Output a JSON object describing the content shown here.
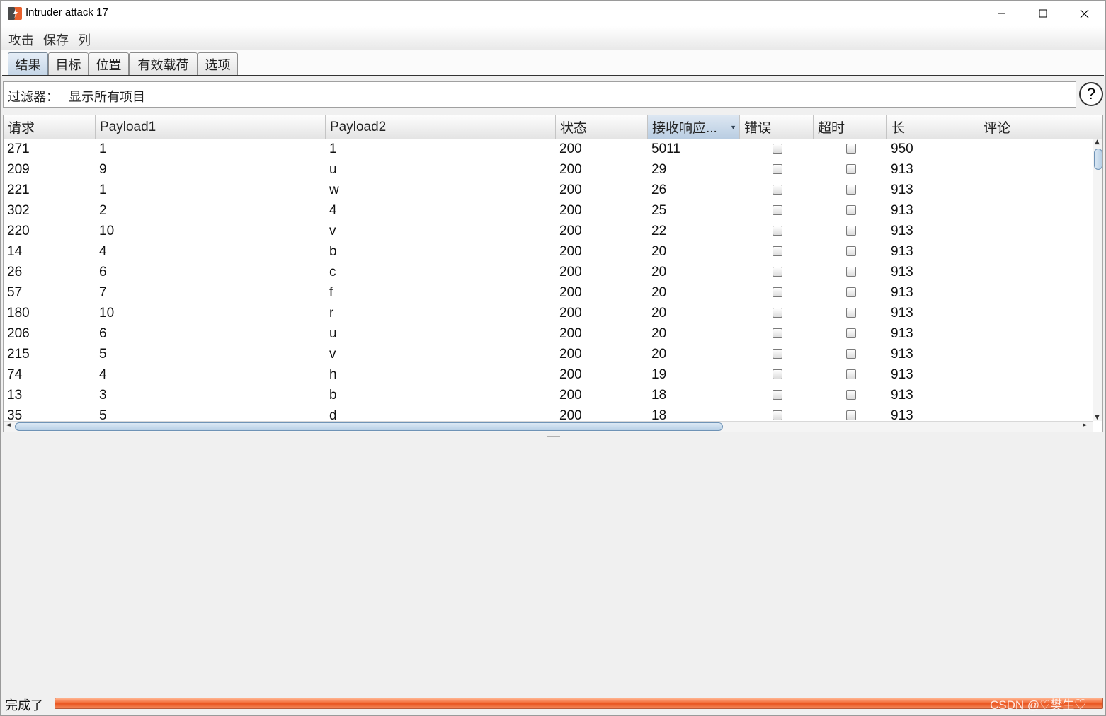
{
  "window": {
    "title": "Intruder attack 17",
    "icon": "burp-app-icon",
    "controls": [
      "minimize-icon",
      "maximize-icon",
      "close-icon"
    ]
  },
  "menu": [
    "攻击",
    "保存",
    "列"
  ],
  "tabs": [
    {
      "label": "结果",
      "active": true
    },
    {
      "label": "目标",
      "active": false
    },
    {
      "label": "位置",
      "active": false
    },
    {
      "label": "有效载荷",
      "active": false
    },
    {
      "label": "选项",
      "active": false
    }
  ],
  "filter": {
    "label": "过滤器：",
    "value": "显示所有项目",
    "help": "?"
  },
  "table": {
    "columns": [
      "请求",
      "Payload1",
      "Payload2",
      "状态",
      "接收响应...",
      "错误",
      "超时",
      "长",
      "评论"
    ],
    "sorted_column": "接收响应...",
    "rows": [
      {
        "request": "271",
        "payload1": "1",
        "payload2": "1",
        "status": "200",
        "response_time": "5011",
        "error": false,
        "timeout": false,
        "length": "950",
        "comment": ""
      },
      {
        "request": "209",
        "payload1": "9",
        "payload2": "u",
        "status": "200",
        "response_time": "29",
        "error": false,
        "timeout": false,
        "length": "913",
        "comment": ""
      },
      {
        "request": "221",
        "payload1": "1",
        "payload2": "w",
        "status": "200",
        "response_time": "26",
        "error": false,
        "timeout": false,
        "length": "913",
        "comment": ""
      },
      {
        "request": "302",
        "payload1": "2",
        "payload2": "4",
        "status": "200",
        "response_time": "25",
        "error": false,
        "timeout": false,
        "length": "913",
        "comment": ""
      },
      {
        "request": "220",
        "payload1": "10",
        "payload2": "v",
        "status": "200",
        "response_time": "22",
        "error": false,
        "timeout": false,
        "length": "913",
        "comment": ""
      },
      {
        "request": "14",
        "payload1": "4",
        "payload2": "b",
        "status": "200",
        "response_time": "20",
        "error": false,
        "timeout": false,
        "length": "913",
        "comment": ""
      },
      {
        "request": "26",
        "payload1": "6",
        "payload2": "c",
        "status": "200",
        "response_time": "20",
        "error": false,
        "timeout": false,
        "length": "913",
        "comment": ""
      },
      {
        "request": "57",
        "payload1": "7",
        "payload2": "f",
        "status": "200",
        "response_time": "20",
        "error": false,
        "timeout": false,
        "length": "913",
        "comment": ""
      },
      {
        "request": "180",
        "payload1": "10",
        "payload2": "r",
        "status": "200",
        "response_time": "20",
        "error": false,
        "timeout": false,
        "length": "913",
        "comment": ""
      },
      {
        "request": "206",
        "payload1": "6",
        "payload2": "u",
        "status": "200",
        "response_time": "20",
        "error": false,
        "timeout": false,
        "length": "913",
        "comment": ""
      },
      {
        "request": "215",
        "payload1": "5",
        "payload2": "v",
        "status": "200",
        "response_time": "20",
        "error": false,
        "timeout": false,
        "length": "913",
        "comment": ""
      },
      {
        "request": "74",
        "payload1": "4",
        "payload2": "h",
        "status": "200",
        "response_time": "19",
        "error": false,
        "timeout": false,
        "length": "913",
        "comment": ""
      },
      {
        "request": "13",
        "payload1": "3",
        "payload2": "b",
        "status": "200",
        "response_time": "18",
        "error": false,
        "timeout": false,
        "length": "913",
        "comment": ""
      },
      {
        "request": "35",
        "payload1": "5",
        "payload2": "d",
        "status": "200",
        "response_time": "18",
        "error": false,
        "timeout": false,
        "length": "913",
        "comment": ""
      }
    ]
  },
  "status": {
    "text": "完成了",
    "progress": 1.0,
    "progress_color": "#f26a36"
  },
  "watermark": "CSDN @♡樊生♡"
}
